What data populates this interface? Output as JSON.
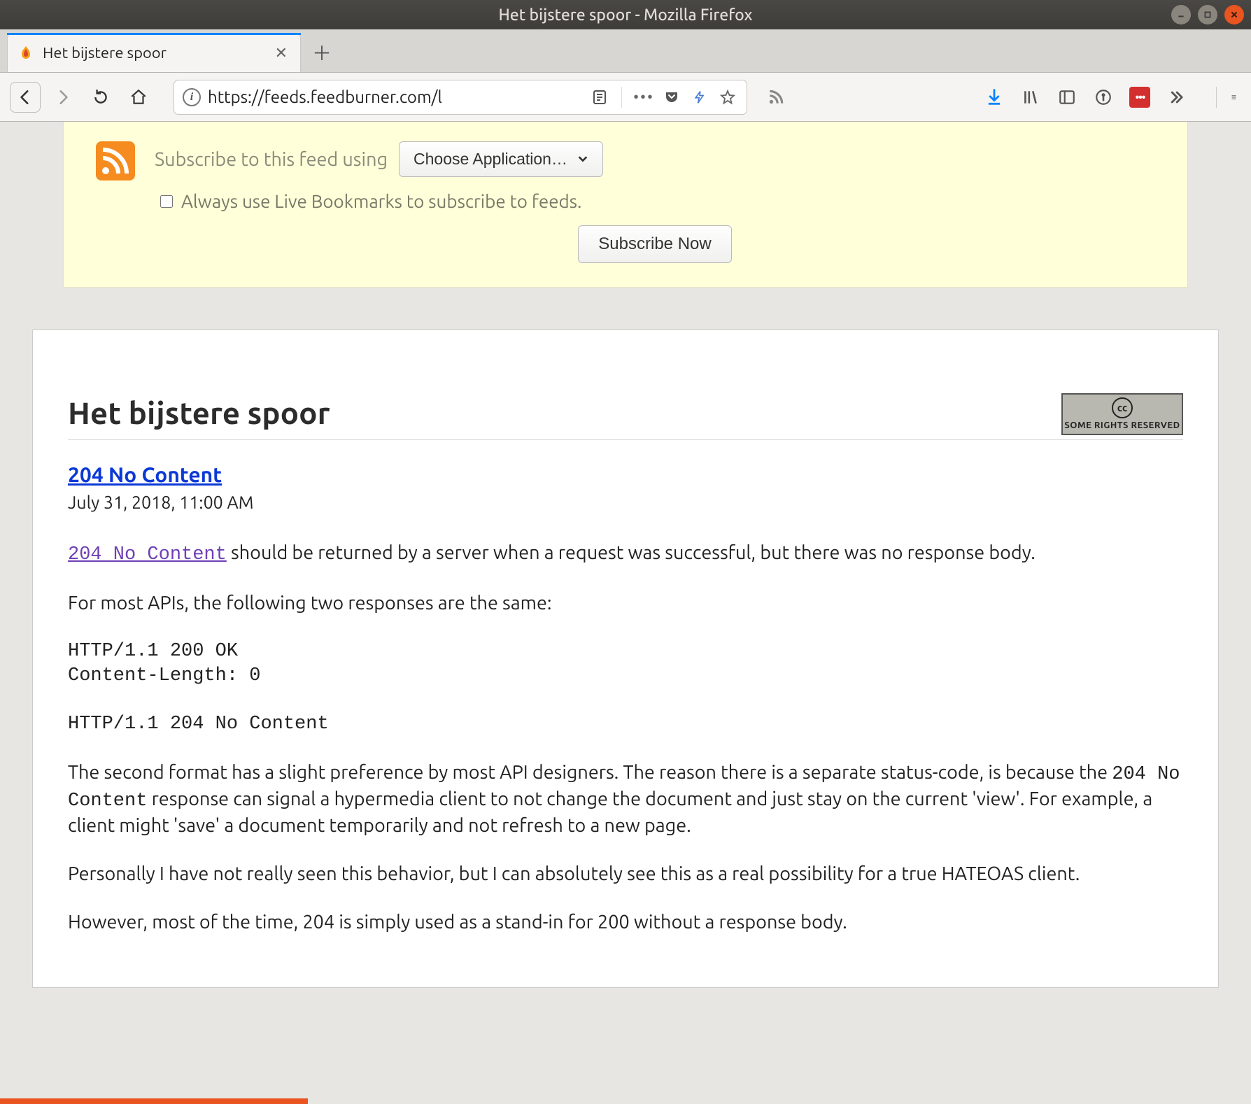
{
  "window": {
    "title": "Het bijstere spoor - Mozilla Firefox"
  },
  "tab": {
    "title": "Het bijstere spoor"
  },
  "url": "https://feeds.feedburner.com/l",
  "subscribe": {
    "label": "Subscribe to this feed using",
    "choose": "Choose Application…",
    "always": "Always use Live Bookmarks to subscribe to feeds.",
    "now": "Subscribe Now"
  },
  "article": {
    "feed_title": "Het bijstere spoor",
    "cc_label": "SOME RIGHTS RESERVED",
    "post_title": "204 No Content",
    "post_date": "July 31, 2018, 11:00 AM",
    "link_text": "204 No Content",
    "p1_rest": " should be returned by a server when a request was successful, but there was no response body.",
    "p2": "For most APIs, the following two responses are the same:",
    "code1a": "HTTP/1.1 200 OK",
    "code1b": "Content-Length: 0",
    "code2": "HTTP/1.1 204 No Content",
    "p3a": "The second format has a slight preference by most API designers. The reason there is a separate status-code, is because the ",
    "p3_mono": "204 No Content",
    "p3b": " response can signal a hypermedia client to not change the document and just stay on the current 'view'. For example, a client might 'save' a document temporarily and not refresh to a new page.",
    "p4": "Personally I have not really seen this behavior, but I can absolutely see this as a real possibility for a true HATEOAS client.",
    "p5": "However, most of the time, 204 is simply used as a stand-in for 200 without a response body."
  }
}
